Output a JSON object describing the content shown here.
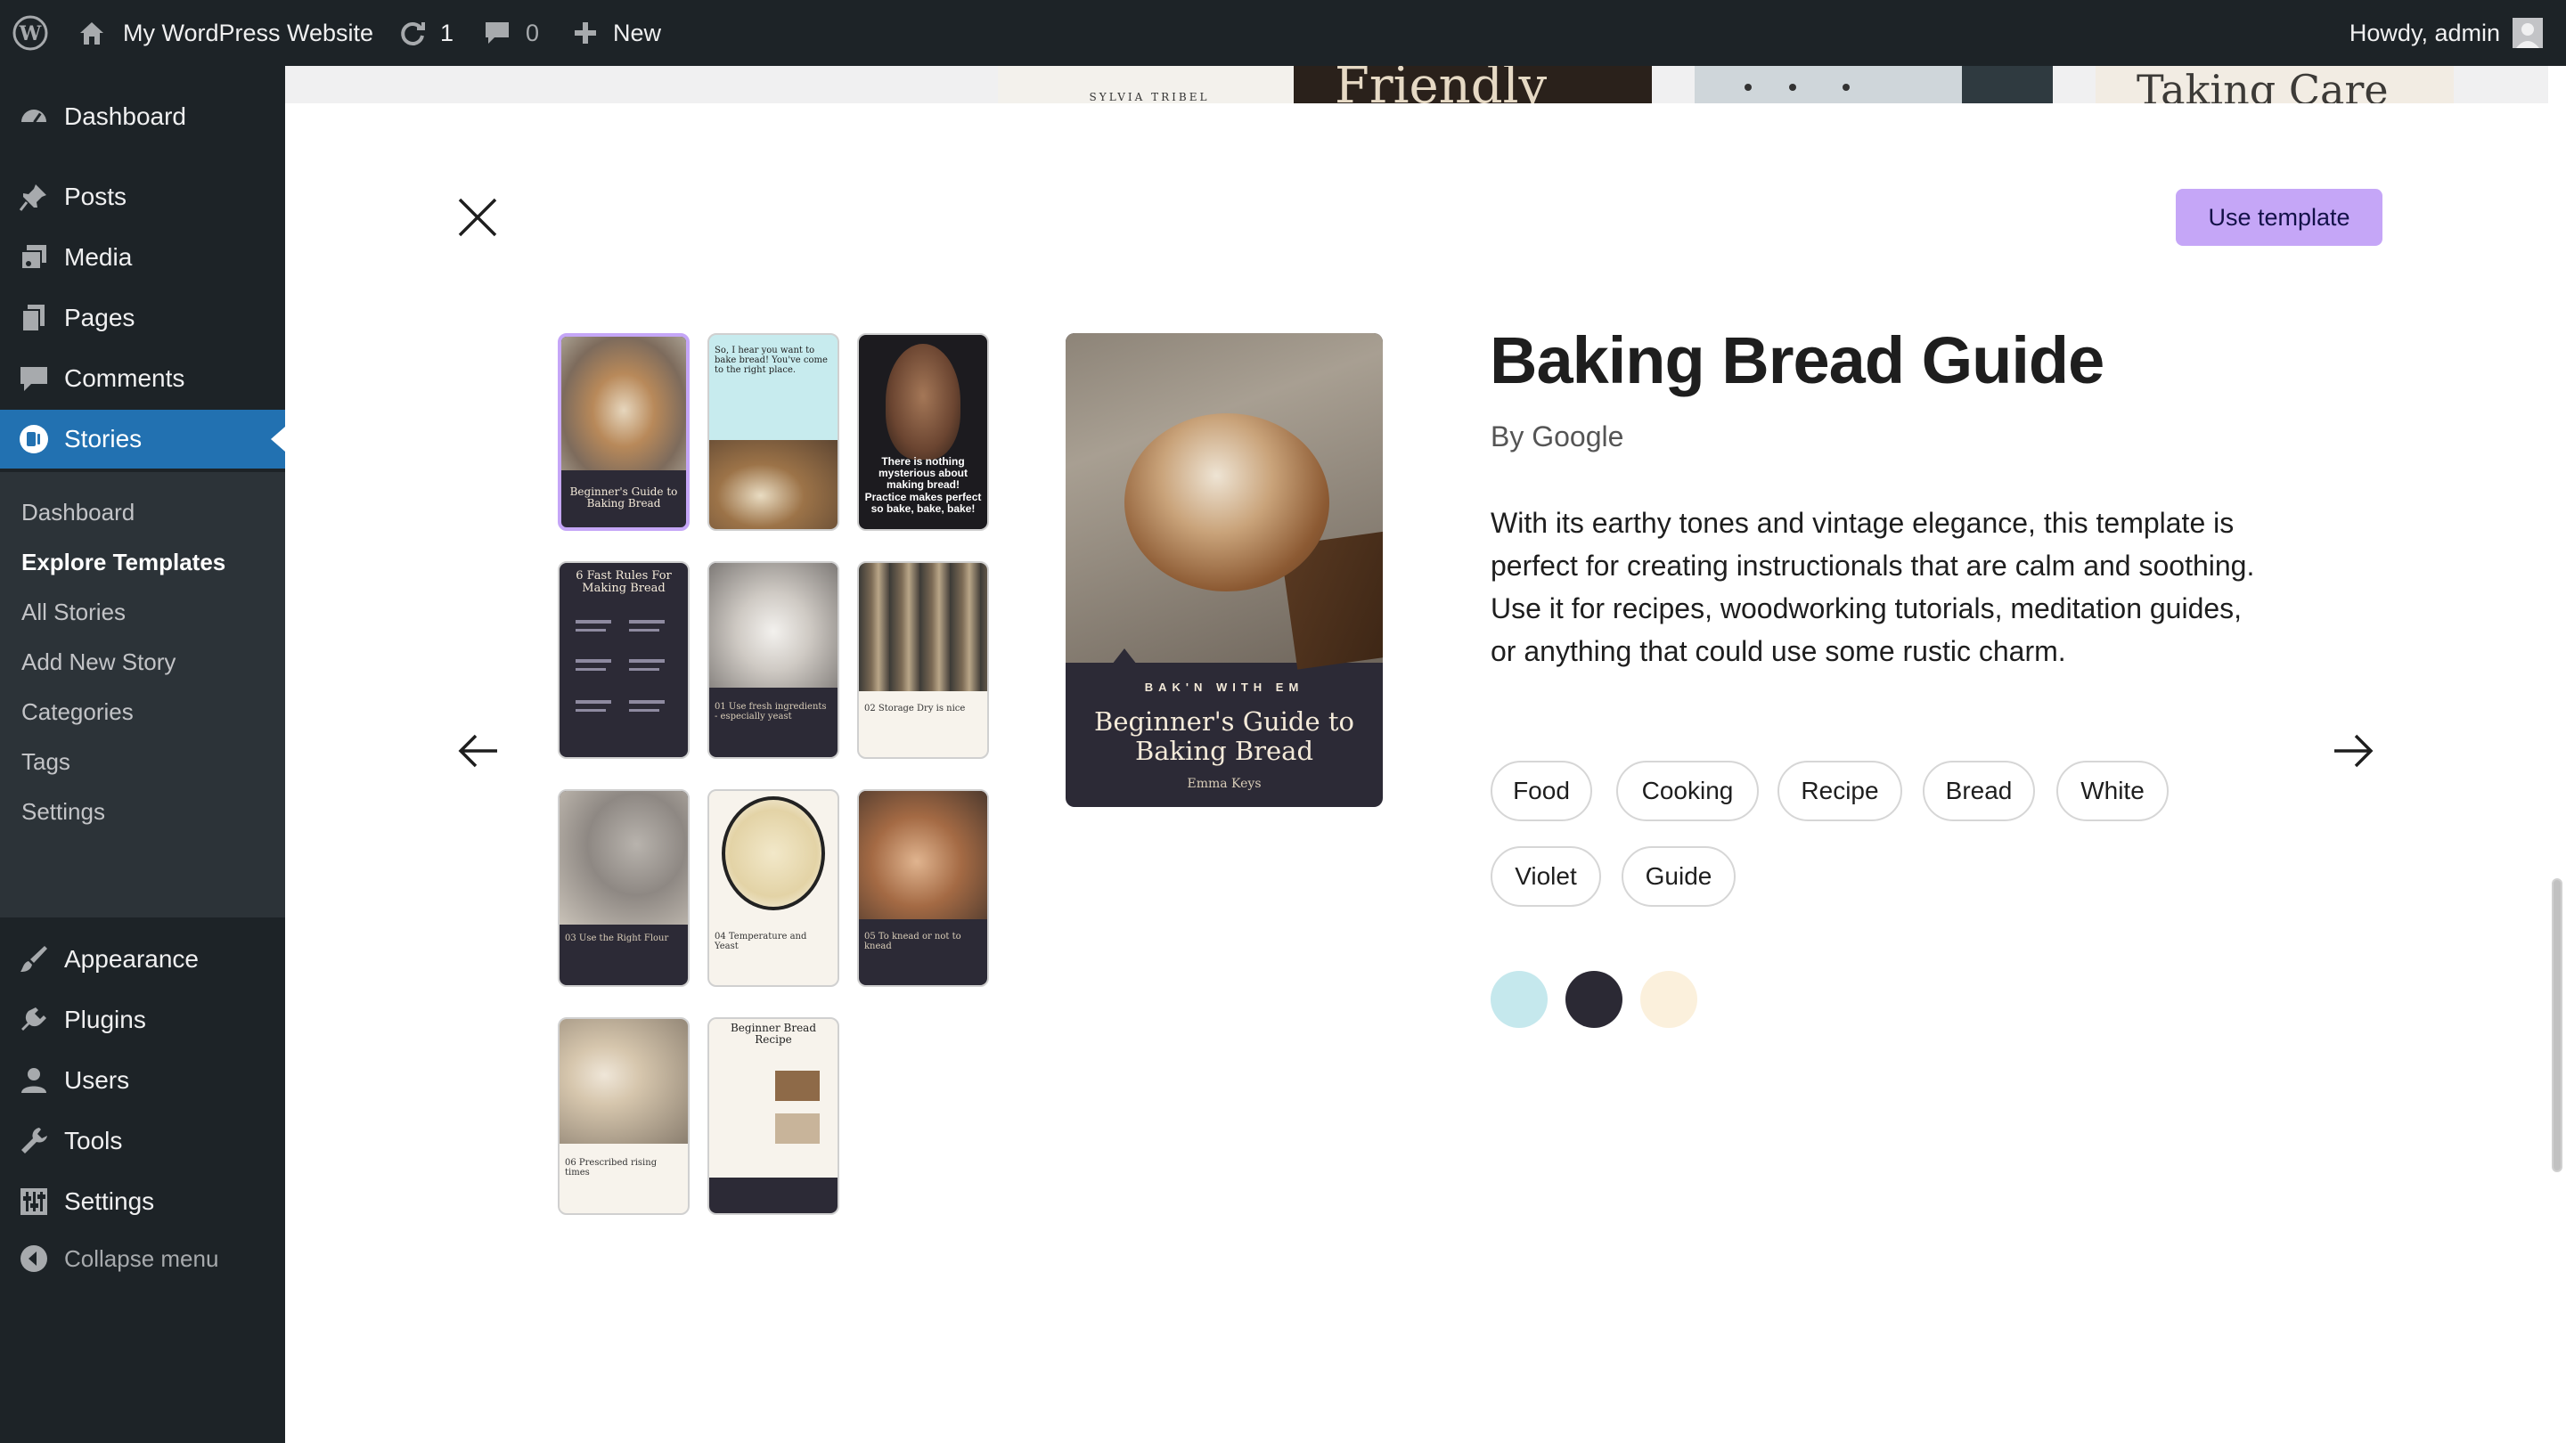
{
  "adminbar": {
    "site_name": "My WordPress Website",
    "updates_count": "1",
    "comments_count": "0",
    "new_label": "New",
    "howdy": "Howdy, admin"
  },
  "sidebar": {
    "items": [
      {
        "label": "Dashboard"
      },
      {
        "label": "Posts"
      },
      {
        "label": "Media"
      },
      {
        "label": "Pages"
      },
      {
        "label": "Comments"
      },
      {
        "label": "Stories"
      },
      {
        "label": "Appearance"
      },
      {
        "label": "Plugins"
      },
      {
        "label": "Users"
      },
      {
        "label": "Tools"
      },
      {
        "label": "Settings"
      },
      {
        "label": "Collapse menu"
      }
    ],
    "submenu": [
      {
        "label": "Dashboard"
      },
      {
        "label": "Explore Templates"
      },
      {
        "label": "All Stories"
      },
      {
        "label": "Add New Story"
      },
      {
        "label": "Categories"
      },
      {
        "label": "Tags"
      },
      {
        "label": "Settings"
      }
    ]
  },
  "background": {
    "card1_text": "SYLVIA TRIBEL",
    "card2_text": "Friendly",
    "card3_text": "Taking Care"
  },
  "modal": {
    "use_template_label": "Use template",
    "thumbnails": [
      {
        "caption": "Beginner's Guide to Baking Bread"
      },
      {
        "caption": "So, I hear you want to bake bread! You've come to the right place."
      },
      {
        "caption": "There is nothing mysterious about making bread! Practice makes perfect so bake, bake, bake!"
      },
      {
        "caption": "6 Fast Rules For Making Bread"
      },
      {
        "caption": "01 Use fresh ingredients - especially yeast"
      },
      {
        "caption": "02 Storage Dry is nice"
      },
      {
        "caption": "03 Use the Right Flour"
      },
      {
        "caption": "04 Temperature and Yeast"
      },
      {
        "caption": "05 To knead or not to knead"
      },
      {
        "caption": "06 Prescribed rising times"
      },
      {
        "caption": "Beginner Bread Recipe"
      }
    ],
    "preview": {
      "kicker": "BAK'N WITH EM",
      "title": "Beginner's Guide to Baking Bread",
      "author": "Emma Keys"
    },
    "title": "Baking Bread Guide",
    "byline": "By Google",
    "description": "With its earthy tones and vintage elegance, this template is perfect for creating instructionals that are calm and soothing. Use it for recipes, woodworking tutorials, meditation guides, or anything that could use some rustic charm.",
    "tags": [
      "Food",
      "Cooking",
      "Recipe",
      "Bread",
      "White",
      "Violet",
      "Guide"
    ],
    "colors": [
      "#c5e8ed",
      "#2b2934",
      "#fbf0dc"
    ]
  }
}
